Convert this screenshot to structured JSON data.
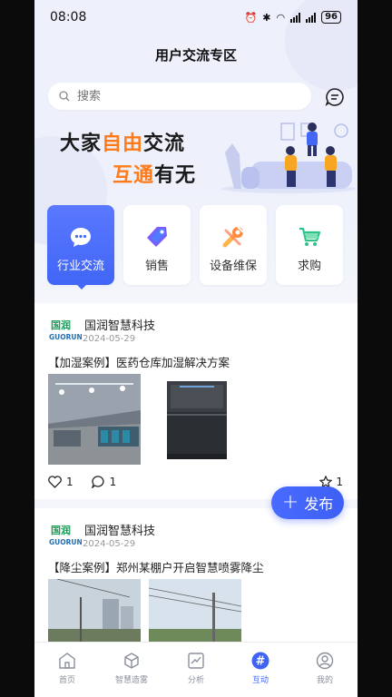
{
  "status": {
    "time": "08:08",
    "battery": "96"
  },
  "header": {
    "title": "用户交流专区"
  },
  "search": {
    "placeholder": "搜索"
  },
  "banner": {
    "line1_a": "大家",
    "line1_b": "自由",
    "line1_c": "交流",
    "line2_a": "互通",
    "line2_b": "有无"
  },
  "categories": [
    {
      "label": "行业交流",
      "icon": "chat-bubble-icon"
    },
    {
      "label": "销售",
      "icon": "price-tag-icon"
    },
    {
      "label": "设备维保",
      "icon": "wrench-icon"
    },
    {
      "label": "求购",
      "icon": "shopping-cart-icon"
    }
  ],
  "posts": [
    {
      "author": "国润智慧科技",
      "date": "2024-05-29",
      "title": "【加湿案例】医药仓库加湿解决方案",
      "likes": "1",
      "comments": "1",
      "favorites": "1"
    },
    {
      "author": "国润智慧科技",
      "date": "2024-05-29",
      "title": "【降尘案例】郑州某棚户开启智慧喷雾降尘"
    }
  ],
  "logo_text": {
    "cn": "国润",
    "en": "GUORUN"
  },
  "fab": {
    "label": "发布"
  },
  "tabs": [
    {
      "label": "首页",
      "icon": "home-icon"
    },
    {
      "label": "智慧造雾",
      "icon": "cube-icon"
    },
    {
      "label": "分析",
      "icon": "chart-icon"
    },
    {
      "label": "互动",
      "icon": "hash-icon"
    },
    {
      "label": "我的",
      "icon": "user-icon"
    }
  ],
  "colors": {
    "accent": "#3f63f4",
    "highlight": "#ff7a1a",
    "background": "#f4f6fb"
  }
}
